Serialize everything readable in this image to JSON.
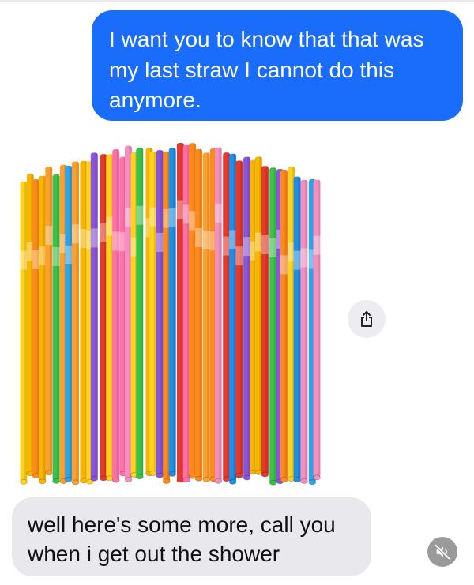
{
  "conversation": {
    "sent_message": "I want you to know that that was my last straw I cannot do this anymore.",
    "received_message": "well here's some more, call you when i get out the shower"
  },
  "icons": {
    "share": "share-icon",
    "mute": "speaker-muted-icon"
  },
  "colors": {
    "sent_bubble": "#1a6dfb",
    "received_bubble": "#e9e9ed",
    "share_button_bg": "#ededf1",
    "mute_button_bg": "#9a9a9a"
  }
}
